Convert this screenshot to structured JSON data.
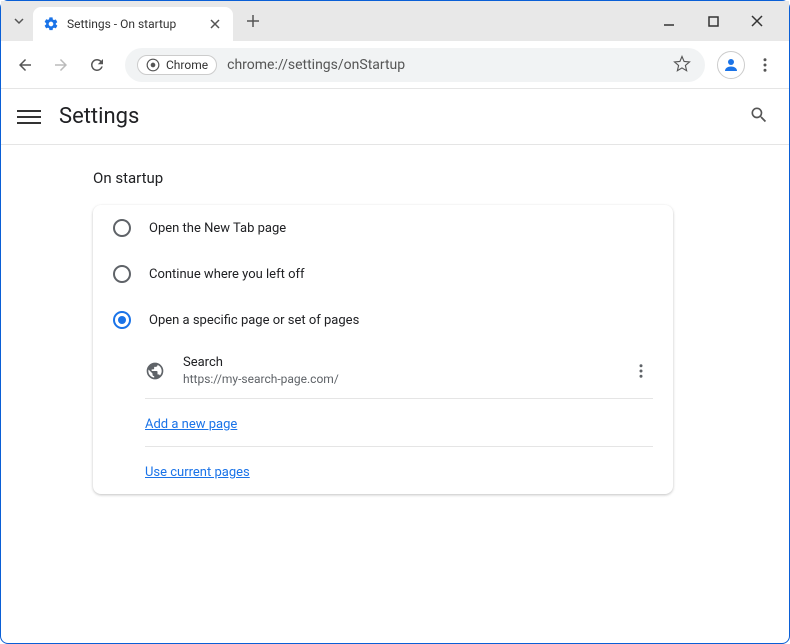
{
  "tab": {
    "title": "Settings - On startup"
  },
  "omnibox": {
    "chip": "Chrome",
    "url": "chrome://settings/onStartup"
  },
  "header": {
    "title": "Settings"
  },
  "section": {
    "title": "On startup"
  },
  "options": {
    "opt1": "Open the New Tab page",
    "opt2": "Continue where you left off",
    "opt3": "Open a specific page or set of pages"
  },
  "pages": [
    {
      "name": "Search",
      "url": "https://my-search-page.com/"
    }
  ],
  "links": {
    "add": "Add a new page",
    "use_current": "Use current pages"
  }
}
